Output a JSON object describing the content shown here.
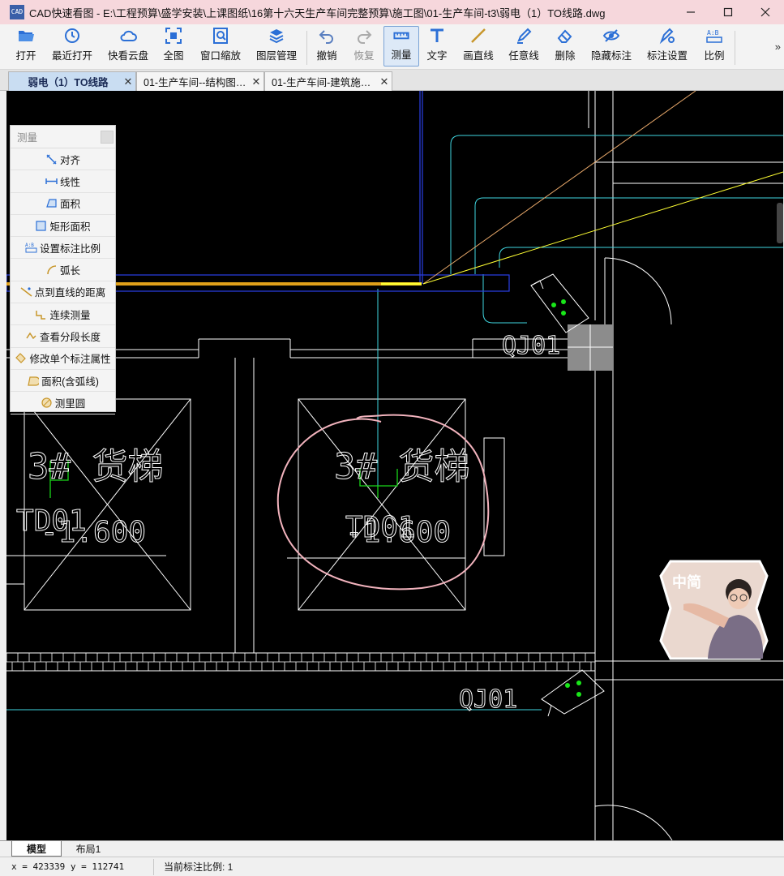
{
  "app": {
    "title": "CAD快速看图 - E:\\工程预算\\盛学安装\\上课图纸\\16第十六天生产车间完整预算\\施工图\\01-生产车间-t3\\弱电（1）TO线路.dwg",
    "icon_text": "CAD"
  },
  "toolbar": {
    "items": [
      {
        "label": "打开",
        "icon": "folder-open-icon"
      },
      {
        "label": "最近打开",
        "icon": "clock-history-icon"
      },
      {
        "label": "快看云盘",
        "icon": "cloud-icon"
      },
      {
        "label": "全图",
        "icon": "fullview-icon"
      },
      {
        "label": "窗口缩放",
        "icon": "zoom-window-icon"
      },
      {
        "label": "图层管理",
        "icon": "layers-icon"
      },
      {
        "label": "撤销",
        "icon": "undo-icon"
      },
      {
        "label": "恢复",
        "icon": "redo-icon"
      },
      {
        "label": "测量",
        "icon": "measure-icon"
      },
      {
        "label": "文字",
        "icon": "text-icon"
      },
      {
        "label": "画直线",
        "icon": "line-icon"
      },
      {
        "label": "任意线",
        "icon": "pen-icon"
      },
      {
        "label": "删除",
        "icon": "eraser-icon"
      },
      {
        "label": "隐藏标注",
        "icon": "eye-hide-icon"
      },
      {
        "label": "标注设置",
        "icon": "annotation-settings-icon"
      },
      {
        "label": "比例",
        "icon": "scale-icon"
      }
    ],
    "more": "»"
  },
  "tabs": [
    {
      "label": "弱电（1）TO线路",
      "active": true
    },
    {
      "label": "01-生产车间--结构图…",
      "active": false
    },
    {
      "label": "01-生产车间-建筑施…",
      "active": false
    }
  ],
  "measure_panel": {
    "title": "测量",
    "items": [
      {
        "label": "对齐",
        "icon": "align-measure-icon"
      },
      {
        "label": "线性",
        "icon": "linear-measure-icon"
      },
      {
        "label": "面积",
        "icon": "area-icon"
      },
      {
        "label": "矩形面积",
        "icon": "rect-area-icon"
      },
      {
        "label": "设置标注比例",
        "icon": "scale-setting-icon"
      },
      {
        "label": "弧长",
        "icon": "arc-length-icon"
      },
      {
        "label": "点到直线的距离",
        "icon": "point-line-distance-icon"
      },
      {
        "label": "连续测量",
        "icon": "continuous-measure-icon"
      },
      {
        "label": "查看分段长度",
        "icon": "segment-length-icon"
      },
      {
        "label": "修改单个标注属性",
        "icon": "edit-annotation-icon"
      },
      {
        "label": "面积(含弧线)",
        "icon": "arc-area-icon"
      },
      {
        "label": "测里圆",
        "icon": "circle-measure-icon"
      }
    ]
  },
  "drawing": {
    "labels": {
      "elevator_left": "3#  货梯",
      "elevator_mid": "3#  货梯",
      "elev_left_code": "TD01",
      "elev_left_level": "-1.600",
      "elev_mid_code": "TD01",
      "elev_mid_level": "-1.600",
      "qj_top": "QJ01",
      "qj_bottom": "QJ01"
    }
  },
  "avatar": {
    "text": "中简"
  },
  "layout_tabs": [
    {
      "label": "模型",
      "active": true
    },
    {
      "label": "布局1",
      "active": false
    }
  ],
  "status": {
    "coords": "x = 423339  y = 112741",
    "scale": "当前标注比例: 1"
  }
}
